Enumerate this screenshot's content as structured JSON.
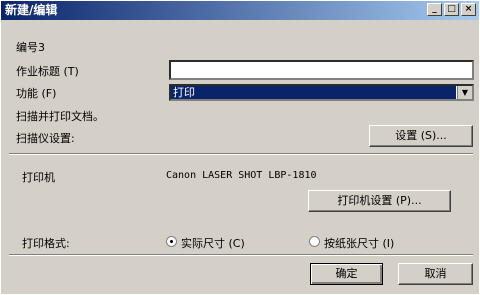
{
  "window": {
    "title": "新建/编辑",
    "min_label": "_",
    "max_label": "□",
    "close_label": "×"
  },
  "form": {
    "number_label": "编号3",
    "job_title_label": "作业标题 (T)",
    "job_title_value": "",
    "function_label": "功能 (F)",
    "function_value": "打印",
    "scan_print_label": "扫描并打印文档。",
    "scanner_settings_label": "扫描仪设置:",
    "settings_button": "设置 (S)..."
  },
  "printer": {
    "label": "打印机",
    "name": "Canon LASER SHOT LBP-1810",
    "settings_button": "打印机设置 (P)..."
  },
  "format": {
    "label": "打印格式:",
    "option_actual": "实际尺寸 (C)",
    "option_fit": "按纸张尺寸 (I)",
    "selected": "actual"
  },
  "footer": {
    "ok": "确定",
    "cancel": "取消"
  }
}
